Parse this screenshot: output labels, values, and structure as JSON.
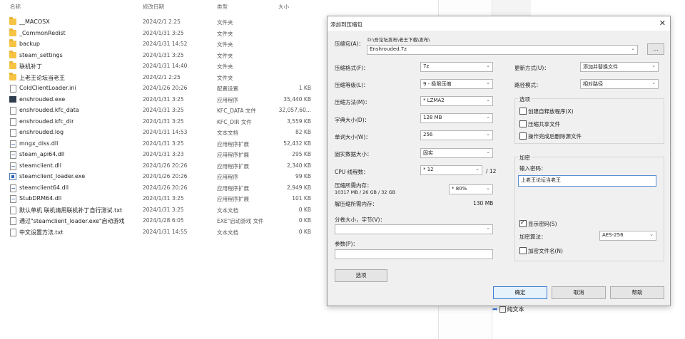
{
  "explorer": {
    "columns": {
      "name": "名称",
      "date": "修改日期",
      "type": "类型",
      "size": "大小"
    },
    "rows": [
      {
        "icon": "folder",
        "name": "__MACOSX",
        "date": "2024/2/1 2:25",
        "type": "文件夹",
        "size": ""
      },
      {
        "icon": "folder",
        "name": "_CommonRedist",
        "date": "2024/1/31 3:25",
        "type": "文件夹",
        "size": ""
      },
      {
        "icon": "folder",
        "name": "backup",
        "date": "2024/1/31 14:52",
        "type": "文件夹",
        "size": ""
      },
      {
        "icon": "folder",
        "name": "steam_settings",
        "date": "2024/1/31 3:25",
        "type": "文件夹",
        "size": ""
      },
      {
        "icon": "folder",
        "name": "联机补丁",
        "date": "2024/1/31 14:40",
        "type": "文件夹",
        "size": ""
      },
      {
        "icon": "folder",
        "name": "上老王论坛当老王",
        "date": "2024/2/1 2:25",
        "type": "文件夹",
        "size": ""
      },
      {
        "icon": "file",
        "name": "ColdClientLoader.ini",
        "date": "2024/1/26 20:26",
        "type": "配置设置",
        "size": "1 KB"
      },
      {
        "icon": "exe",
        "name": "enshrouded.exe",
        "date": "2024/1/31 3:25",
        "type": "应用程序",
        "size": "35,440 KB"
      },
      {
        "icon": "file",
        "name": "enshrouded.kfc_data",
        "date": "2024/1/31 3:25",
        "type": "KFC_DATA 文件",
        "size": "32,057,60..."
      },
      {
        "icon": "file",
        "name": "enshrouded.kfc_dir",
        "date": "2024/1/31 3:25",
        "type": "KFC_DIR 文件",
        "size": "3,559 KB"
      },
      {
        "icon": "file",
        "name": "enshrouded.log",
        "date": "2024/1/31 14:53",
        "type": "文本文档",
        "size": "82 KB"
      },
      {
        "icon": "dll",
        "name": "mngx_diss.dll",
        "date": "2024/1/31 3:25",
        "type": "应用程序扩展",
        "size": "52,432 KB"
      },
      {
        "icon": "dll",
        "name": "steam_api64.dll",
        "date": "2024/1/31 3:23",
        "type": "应用程序扩展",
        "size": "295 KB"
      },
      {
        "icon": "dll",
        "name": "steamclient.dll",
        "date": "2024/1/26 20:26",
        "type": "应用程序扩展",
        "size": "2,340 KB"
      },
      {
        "icon": "exe2",
        "name": "steamclient_loader.exe",
        "date": "2024/1/26 20:26",
        "type": "应用程序",
        "size": "99 KB"
      },
      {
        "icon": "dll",
        "name": "steamclient64.dll",
        "date": "2024/1/26 20:26",
        "type": "应用程序扩展",
        "size": "2,949 KB"
      },
      {
        "icon": "dll",
        "name": "StubDRM64.dll",
        "date": "2024/1/31 3:25",
        "type": "应用程序扩展",
        "size": "101 KB"
      },
      {
        "icon": "file",
        "name": "默认单机 联机请用联机补丁自行测试.txt",
        "date": "2024/1/31 3:25",
        "type": "文本文档",
        "size": "0 KB"
      },
      {
        "icon": "file",
        "name": "通过\"steamclient_loader.exe\"启动游戏",
        "date": "2024/1/28 6:05",
        "type": "EXE\"启动游戏 文件",
        "size": "0 KB"
      },
      {
        "icon": "file",
        "name": "中文设置方法.txt",
        "date": "2024/1/31 14:55",
        "type": "文本文档",
        "size": "0 KB"
      }
    ]
  },
  "dialog": {
    "title": "添加到压缩包",
    "archive_label": "压缩包(A)：",
    "archive_path": "D:\\吾论坛发布\\老王下载\\发布\\",
    "archive_name": "Enshrouded.7z",
    "browse": "...",
    "format_label": "压缩格式(F)：",
    "format_value": "7z",
    "level_label": "压缩等级(L)：",
    "level_value": "9 - 极限压缩",
    "method_label": "压缩方法(M)：",
    "method_value": "* LZMA2",
    "dict_label": "字典大小(D)：",
    "dict_value": "128 MB",
    "word_label": "单词大小(W)：",
    "word_value": "256",
    "solid_label": "固实数据大小：",
    "solid_value": "固实",
    "threads_label": "CPU 线程数：",
    "threads_value": "* 12",
    "threads_max": "/ 12",
    "mem_label": "压缩所需内存：",
    "mem_sub": "10317 MB / 26 GB / 32 GB",
    "mem_pct": "* 80%",
    "mem_value": "",
    "decomp_label": "解压缩所需内存：",
    "decomp_value": "130 MB",
    "split_label": "分卷大小，字节(V)：",
    "params_label": "参数(P)：",
    "options_btn": "选项",
    "update_label": "更新方式(U)：",
    "update_value": "添加并替换文件",
    "path_label": "路径模式：",
    "path_value": "相对路径",
    "opts_group": "选项",
    "opt1": "创建自释放程序(X)",
    "opt2": "压缩共享文件",
    "opt3": "操作完成后删除源文件",
    "enc_group": "加密",
    "pwd_label": "输入密码：",
    "pwd_value": "上老王论坛当老王",
    "show_pwd": "显示密码(S)",
    "enc_method_label": "加密算法：",
    "enc_method_value": "AES-256",
    "enc_names": "加密文件名(N)",
    "ok": "确定",
    "cancel": "取消",
    "help": "帮助"
  },
  "bottom": {
    "plain_text": "纯文本"
  }
}
